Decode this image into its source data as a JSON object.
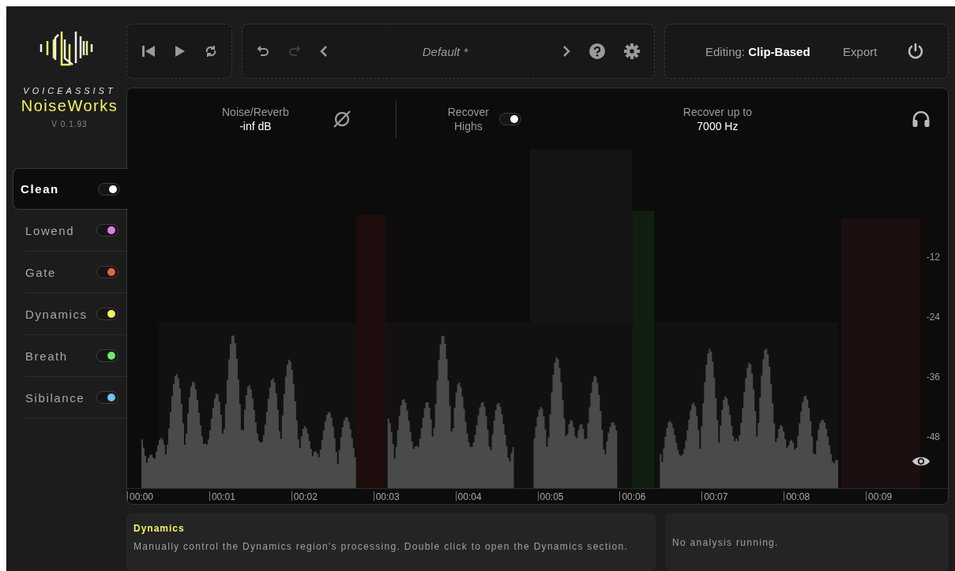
{
  "logo": {
    "brand": "VOICEASSIST",
    "product": "NoiseWorks",
    "version": "V 0.1.93"
  },
  "transport": [
    {
      "kind": "skip-back",
      "disabled": false
    },
    {
      "kind": "play",
      "disabled": false
    },
    {
      "kind": "loop",
      "disabled": false
    }
  ],
  "history": [
    {
      "kind": "undo",
      "disabled": false
    },
    {
      "kind": "redo",
      "disabled": true
    }
  ],
  "preset": {
    "name": "Default *"
  },
  "editing": {
    "label": "Editing:",
    "value": "Clip-Based"
  },
  "export": "Export",
  "controls": {
    "noise_reverb": {
      "label": "Noise/Reverb",
      "value": "-inf dB"
    },
    "recover_highs": {
      "label": "Recover Highs",
      "on": true
    },
    "recover_up_to": {
      "label": "Recover up to",
      "value": "7000 Hz"
    }
  },
  "db_scale": [
    "-12",
    "-24",
    "-36",
    "-48"
  ],
  "time_axis": [
    "00:00",
    "00:01",
    "00:02",
    "00:03",
    "00:04",
    "00:05",
    "00:06",
    "00:07",
    "00:08",
    "00:09"
  ],
  "sidebar": {
    "items": [
      {
        "label": "Clean",
        "selected": true,
        "on": true,
        "color": "#ffffff"
      },
      {
        "label": "Lowend",
        "selected": false,
        "on": true,
        "color": "#e07be8"
      },
      {
        "label": "Gate",
        "selected": false,
        "on": true,
        "color": "#e8604f"
      },
      {
        "label": "Dynamics",
        "selected": false,
        "on": true,
        "color": "#f4f065"
      },
      {
        "label": "Breath",
        "selected": false,
        "on": true,
        "color": "#6fe86c"
      },
      {
        "label": "Sibilance",
        "selected": false,
        "on": true,
        "color": "#6cc4f4"
      }
    ]
  },
  "info": {
    "title": "Dynamics",
    "text": "Manually control the Dynamics region's processing. Double click to open the Dynamics section."
  },
  "status": "No analysis running."
}
